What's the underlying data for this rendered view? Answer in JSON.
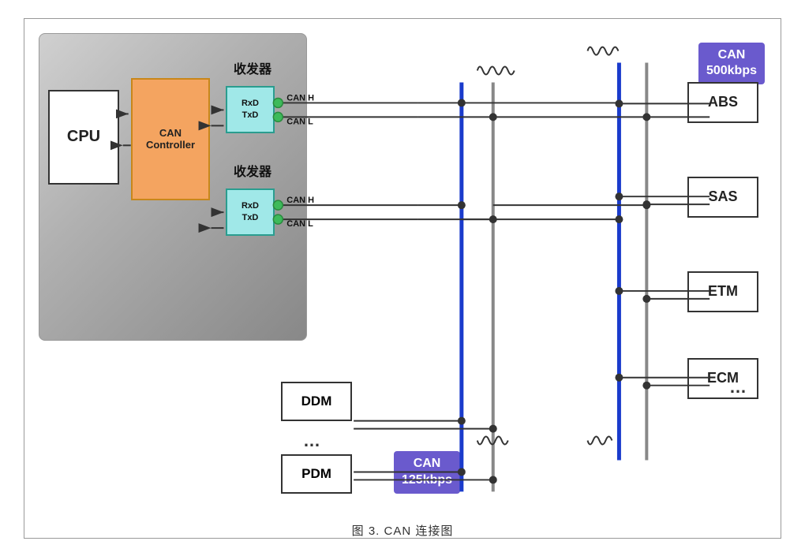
{
  "diagram": {
    "title_caption": "图 3.    CAN 连接图",
    "ecu_block": {
      "cpu_label": "CPU",
      "can_controller_label": "CAN\nController",
      "transceiver1_label": "RxD\nTxD",
      "transceiver2_label": "RxD\nTxD",
      "shoufa_label": "收发器"
    },
    "can_bus_500": "CAN\n500kbps",
    "can_bus_125": "CAN\n125kbps",
    "nodes_right": [
      "ABS",
      "SAS",
      "ETM",
      "ECM"
    ],
    "nodes_bottom": [
      "DDM",
      "PDM"
    ],
    "dots": "…",
    "canh_label1": "CAN H",
    "canl_label1": "CAN L",
    "canh_label2": "CAN H",
    "canl_label2": "CAN L"
  }
}
